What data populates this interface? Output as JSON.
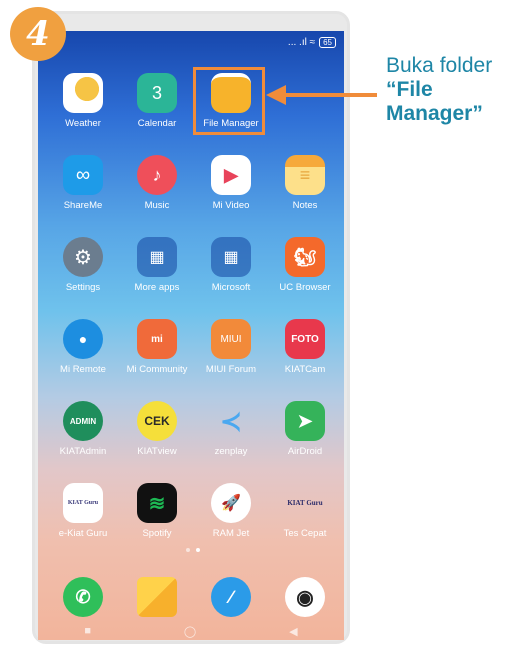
{
  "step": {
    "number": "4"
  },
  "status_bar": {
    "signal": "... .ıl ≈",
    "battery": "65"
  },
  "apps": [
    {
      "label": "Weather",
      "glyph": "⛅"
    },
    {
      "label": "Calendar",
      "glyph": "3"
    },
    {
      "label": "File Manager",
      "glyph": ""
    },
    {
      "label": "ShareMe",
      "glyph": "∞"
    },
    {
      "label": "Music",
      "glyph": "♪"
    },
    {
      "label": "Mi Video",
      "glyph": "▶"
    },
    {
      "label": "Notes",
      "glyph": "≡"
    },
    {
      "label": "Settings",
      "glyph": "⚙"
    },
    {
      "label": "More apps",
      "glyph": "▦"
    },
    {
      "label": "Microsoft",
      "glyph": "▦"
    },
    {
      "label": "UC Browser",
      "glyph": "🐿"
    },
    {
      "label": "Mi Remote",
      "glyph": "●"
    },
    {
      "label": "Mi Community",
      "glyph": "mi"
    },
    {
      "label": "MIUI Forum",
      "glyph": "MIUI"
    },
    {
      "label": "KIATCam",
      "glyph": "FOTO"
    },
    {
      "label": "KIATAdmin",
      "glyph": "ADMIN"
    },
    {
      "label": "KIATview",
      "glyph": "CEK"
    },
    {
      "label": "zenplay",
      "glyph": "≺"
    },
    {
      "label": "AirDroid",
      "glyph": "➤"
    },
    {
      "label": "e-Kiat Guru",
      "glyph": "KIAT Guru"
    },
    {
      "label": "Spotify",
      "glyph": "≋"
    },
    {
      "label": "RAM Jet",
      "glyph": "🚀"
    },
    {
      "label": "Tes Cepat",
      "glyph": "KIAT Guru"
    }
  ],
  "dock": [
    {
      "name": "phone",
      "glyph": "✆"
    },
    {
      "name": "messages",
      "glyph": ""
    },
    {
      "name": "browser",
      "glyph": "∕"
    },
    {
      "name": "camera",
      "glyph": "◉"
    }
  ],
  "nav": {
    "recent": "■",
    "home": "◯",
    "back": "◀"
  },
  "caption": {
    "line1": "Buka folder",
    "line2": "“File",
    "line3": "Manager”"
  },
  "colors": {
    "accent": "#f08c3a",
    "caption": "#1e86a6",
    "step_badge": "#f0a040"
  }
}
